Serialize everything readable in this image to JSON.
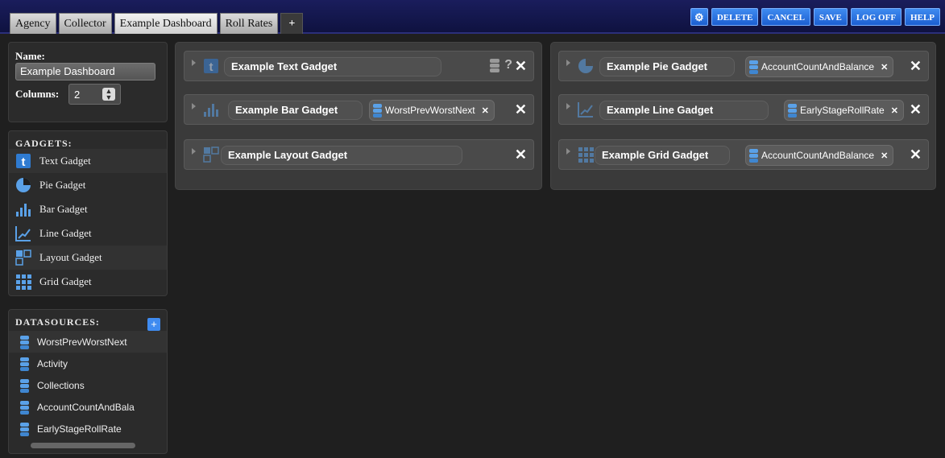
{
  "tabs": [
    "Agency",
    "Collector",
    "Example Dashboard",
    "Roll Rates",
    "+"
  ],
  "toolbar": {
    "gear": "⚙",
    "delete": "DELETE",
    "cancel": "CANCEL",
    "save": "SAVE",
    "logoff": "LOG OFF",
    "help": "HELP"
  },
  "name_panel": {
    "name_label": "Name:",
    "name_value": "Example Dashboard",
    "columns_label": "Columns:",
    "columns_value": "2"
  },
  "gadgets_panel": {
    "title": "GADGETS:",
    "items": [
      "Text Gadget",
      "Pie Gadget",
      "Bar Gadget",
      "Line Gadget",
      "Layout Gadget",
      "Grid Gadget"
    ]
  },
  "datasources_panel": {
    "title": "DATASOURCES:",
    "add": "+",
    "items": [
      "WorstPrevWorstNext",
      "Activity",
      "Collections",
      "AccountCountAndBala",
      "EarlyStageRollRate"
    ]
  },
  "column1": [
    {
      "title": "Example Text Gadget",
      "datasource": "",
      "extra": "?"
    },
    {
      "title": "Example Bar Gadget",
      "datasource": "WorstPrevWorstNext"
    },
    {
      "title": "Example Layout Gadget",
      "datasource": ""
    }
  ],
  "column2": [
    {
      "title": "Example Pie Gadget",
      "datasource": "AccountCountAndBalance"
    },
    {
      "title": "Example Line Gadget",
      "datasource": "EarlyStageRollRate"
    },
    {
      "title": "Example Grid Gadget",
      "datasource": "AccountCountAndBalance"
    }
  ],
  "close_glyph": "✕",
  "chip_close_glyph": "✕",
  "colors": {
    "accent": "#3f8bf0",
    "topbar": "#1a1d5c",
    "icon_blue": "#5aa1e8"
  }
}
